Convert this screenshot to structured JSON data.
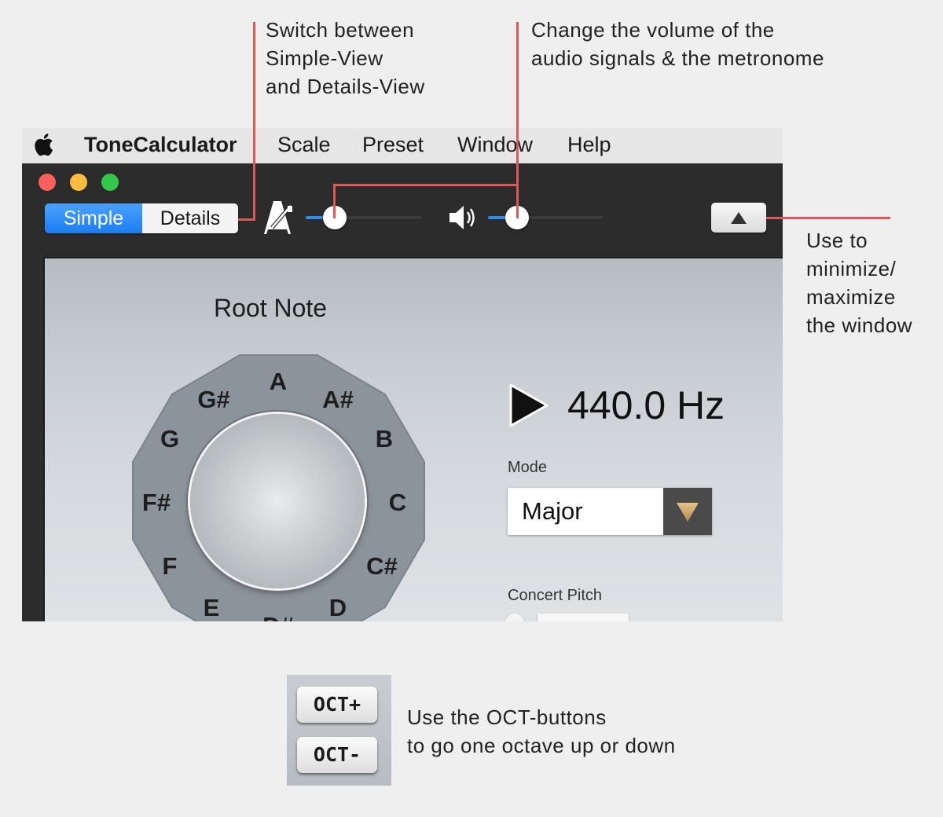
{
  "annotations": {
    "view_switch": "Switch between\nSimple-View\nand Details-View",
    "volume": "Change the volume of the\naudio signals & the metronome",
    "minimize": "Use to\nminimize/\nmaximize\nthe window",
    "oct": "Use the OCT-buttons\nto go one octave up or down"
  },
  "menubar": {
    "app_name": "ToneCalculator",
    "items": [
      "Scale",
      "Preset",
      "Window",
      "Help"
    ]
  },
  "toolbar": {
    "segments": [
      "Simple",
      "Details"
    ],
    "selected_segment": "Simple",
    "metronome_volume": 0.25,
    "audio_volume": 0.25
  },
  "content": {
    "root_note_label": "Root Note",
    "notes": [
      "A",
      "A#",
      "B",
      "C",
      "C#",
      "D",
      "D#",
      "E",
      "F",
      "F#",
      "G",
      "G#"
    ],
    "frequency": "440.0 Hz",
    "mode_label": "Mode",
    "mode_value": "Major",
    "concert_pitch_label": "Concert Pitch"
  },
  "oct_buttons": {
    "up": "OCT+",
    "down": "OCT-"
  },
  "colors": {
    "accent_blue": "#2d8cf0",
    "annotation_line": "#e0575a",
    "traffic_red": "#fc605c",
    "traffic_yellow": "#fdbc40",
    "traffic_green": "#34c84a"
  }
}
